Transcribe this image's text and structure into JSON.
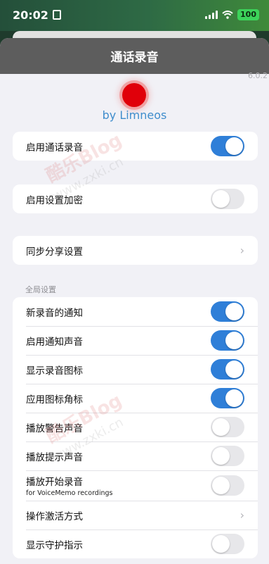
{
  "status_bar": {
    "time": "20:02",
    "battery": "100"
  },
  "nav": {
    "title": "通话录音"
  },
  "version_text": "6.0.2",
  "byline": "by Limneos",
  "groups": {
    "enable_recording": {
      "label": "启用通话录音",
      "on": true
    },
    "enable_encryption": {
      "label": "启用设置加密",
      "on": false
    },
    "sync_share": {
      "label": "同步分享设置"
    }
  },
  "global_section": {
    "header": "全局设置",
    "rows": [
      {
        "label": "新录音的通知",
        "type": "toggle",
        "on": true
      },
      {
        "label": "启用通知声音",
        "type": "toggle",
        "on": true
      },
      {
        "label": "显示录音图标",
        "type": "toggle",
        "on": true
      },
      {
        "label": "应用图标角标",
        "type": "toggle",
        "on": true
      },
      {
        "label": "播放警告声音",
        "type": "toggle",
        "on": false
      },
      {
        "label": "播放提示声音",
        "type": "toggle",
        "on": false
      },
      {
        "label": "播放开始录音",
        "sublabel": "for VoiceMemo recordings",
        "type": "toggle",
        "on": false
      },
      {
        "label": "操作激活方式",
        "type": "chevron"
      },
      {
        "label": "显示守护指示",
        "type": "toggle",
        "on": false
      }
    ]
  },
  "watermark": {
    "line1": "酷乐Blog",
    "line2": "www.zxki.cn"
  }
}
